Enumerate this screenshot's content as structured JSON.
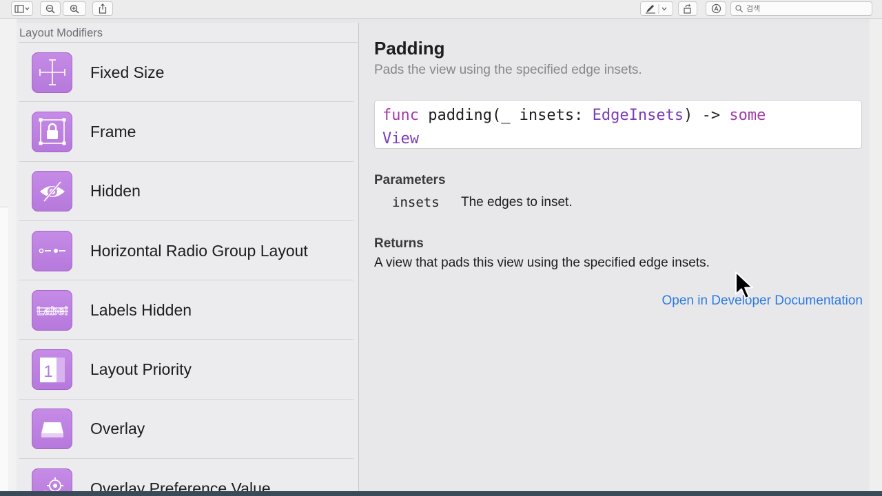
{
  "toolbar": {
    "search_placeholder": "검색",
    "icons": [
      "sidebar-toggle-icon",
      "zoom-out-icon",
      "zoom-in-icon",
      "share-icon",
      "markup-pen-icon",
      "rotate-icon",
      "annotate-icon",
      "search-icon"
    ]
  },
  "library": {
    "section_title": "Layout Modifiers",
    "items": [
      {
        "label": "Fixed Size",
        "icon": "fixed-size-icon"
      },
      {
        "label": "Frame",
        "icon": "frame-icon"
      },
      {
        "label": "Hidden",
        "icon": "hidden-icon"
      },
      {
        "label": "Horizontal Radio Group Layout",
        "icon": "radio-group-icon"
      },
      {
        "label": "Labels Hidden",
        "icon": "labels-hidden-icon",
        "icon_text": "Label"
      },
      {
        "label": "Layout Priority",
        "icon": "layout-priority-icon",
        "icon_text": "1"
      },
      {
        "label": "Overlay",
        "icon": "overlay-icon"
      },
      {
        "label": "Overlay Preference Value",
        "icon": "overlay-preference-icon"
      }
    ]
  },
  "detail": {
    "title": "Padding",
    "subtitle": "Pads the view using the specified edge insets.",
    "signature": {
      "keyword_func": "func",
      "name": " padding(_ insets: ",
      "type_param": "EdgeInsets",
      "arrow": ") -> ",
      "keyword_some": "some",
      "return_type": "View"
    },
    "parameters_heading": "Parameters",
    "parameters": [
      {
        "name": "insets",
        "description": "The edges to inset."
      }
    ],
    "returns_heading": "Returns",
    "returns_description": "A view that pads this view using the specified edge insets.",
    "doc_link": "Open in Developer Documentation"
  },
  "colors": {
    "icon_purple": "#bf84e2",
    "keyword": "#a63aa8",
    "type": "#7b3ab8",
    "link": "#2a7ae2"
  }
}
